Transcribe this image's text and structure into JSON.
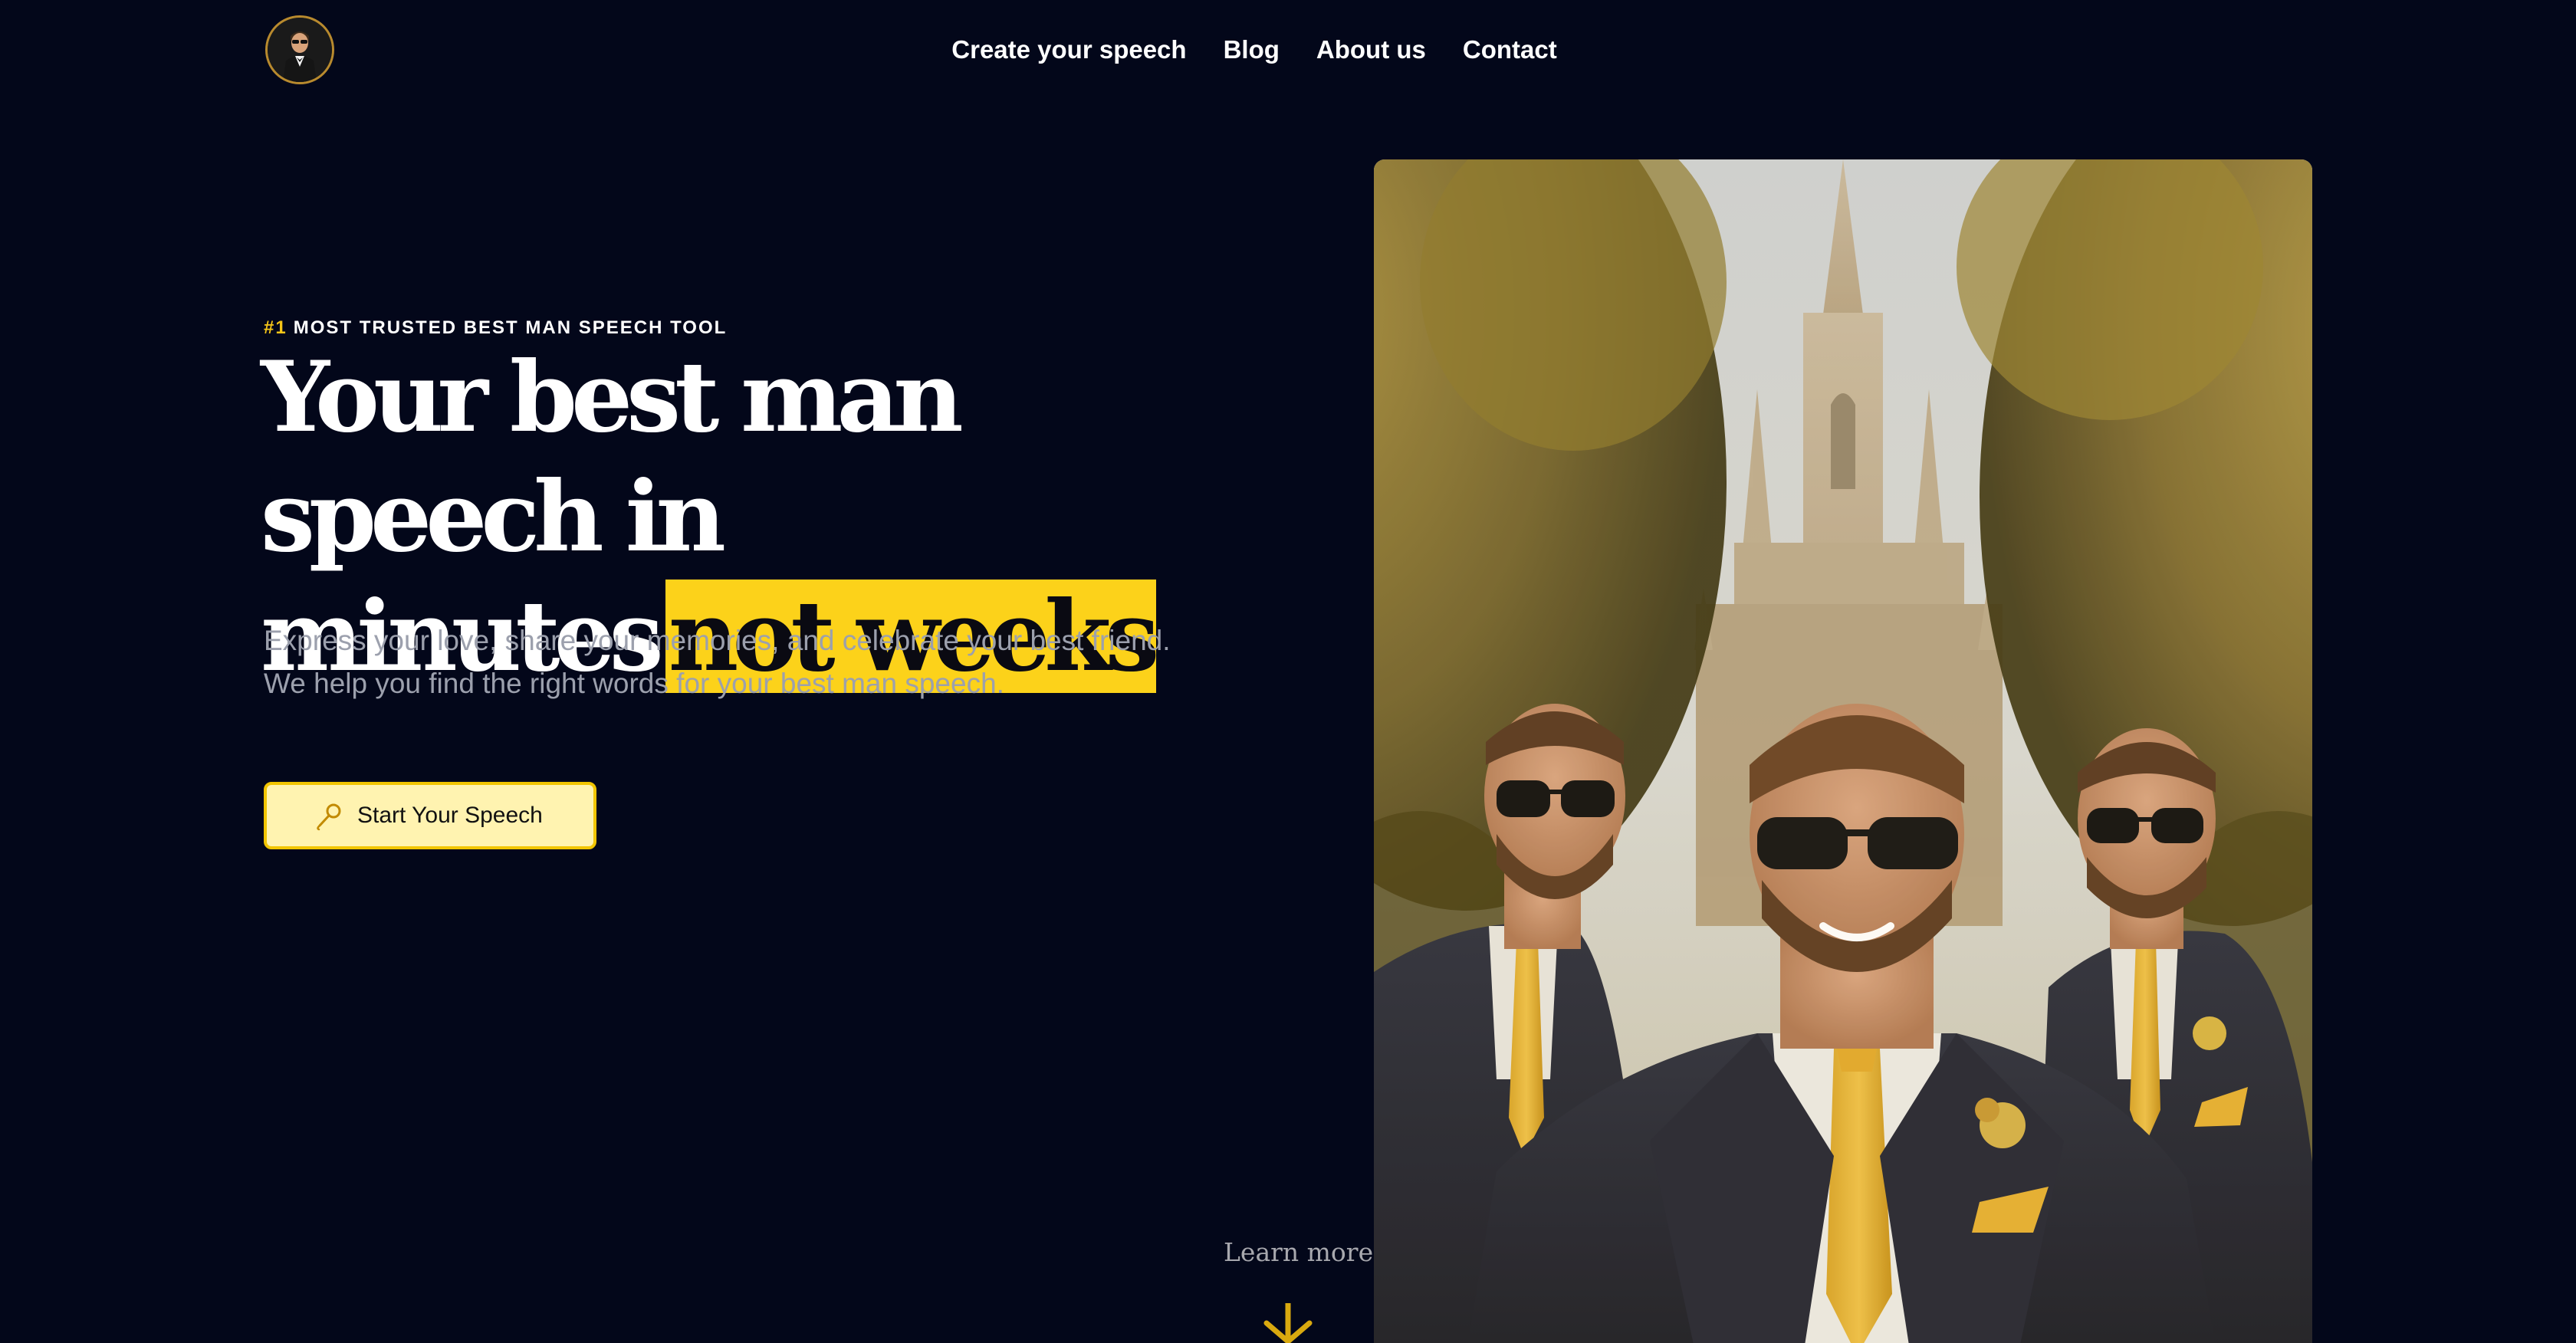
{
  "header": {
    "logo_icon": "tuxedo-man-avatar-icon",
    "nav": [
      {
        "label": "Create your speech"
      },
      {
        "label": "Blog"
      },
      {
        "label": "About us"
      },
      {
        "label": "Contact"
      }
    ]
  },
  "hero": {
    "eyebrow_number": "#1",
    "eyebrow_text": "MOST TRUSTED BEST MAN SPEECH TOOL",
    "headline_line1": "Your best man speech in",
    "headline_line2_start": "minutes",
    "headline_highlight": "not weeks",
    "subtext": "Express your love, share your memories, and celebrate your best friend. We help you find the right words for your best man speech.",
    "cta_label": "Start Your Speech",
    "cta_icon": "microphone-icon"
  },
  "learn_more": {
    "label": "Learn more",
    "icon": "arrow-down-icon"
  },
  "colors": {
    "background": "#03071a",
    "accent": "#fcd21a",
    "button_bg": "#fff3b0",
    "subtext": "#9ca0ad"
  }
}
